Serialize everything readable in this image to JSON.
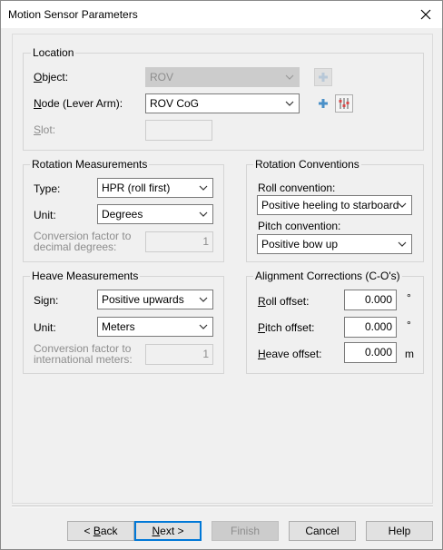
{
  "window": {
    "title": "Motion Sensor Parameters",
    "close_symbol": "✕"
  },
  "location": {
    "title": "Location",
    "object_label": "Object:",
    "object_value": "ROV",
    "node_label": "Node (Lever Arm):",
    "node_value": "ROV CoG",
    "slot_label": "Slot:",
    "slot_value": ""
  },
  "rotation_measurements": {
    "title": "Rotation Measurements",
    "type_label": "Type:",
    "type_value": "HPR (roll first)",
    "unit_label": "Unit:",
    "unit_value": "Degrees",
    "conversion_label": "Conversion factor to decimal degrees:",
    "conversion_value": "1"
  },
  "rotation_conventions": {
    "title": "Rotation Conventions",
    "roll_label": "Roll convention:",
    "roll_value": "Positive heeling to starboard",
    "pitch_label": "Pitch convention:",
    "pitch_value": "Positive bow up"
  },
  "heave_measurements": {
    "title": "Heave Measurements",
    "sign_label": "Sign:",
    "sign_value": "Positive upwards",
    "unit_label": "Unit:",
    "unit_value": "Meters",
    "conversion_label": "Conversion factor to international meters:",
    "conversion_value": "1"
  },
  "alignment_corrections": {
    "title": "Alignment Corrections (C-O's)",
    "roll_label": "Roll offset:",
    "roll_value": "0.000",
    "roll_unit": "°",
    "pitch_label": "Pitch offset:",
    "pitch_value": "0.000",
    "pitch_unit": "°",
    "heave_label": "Heave offset:",
    "heave_value": "0.000",
    "heave_unit": "m"
  },
  "buttons": {
    "back": "< Back",
    "next": "Next >",
    "finish": "Finish",
    "cancel": "Cancel",
    "help": "Help"
  },
  "colors": {
    "accent": "#0078d7",
    "add_icon": "#4a90c8",
    "disabled_bg": "#cccccc"
  }
}
